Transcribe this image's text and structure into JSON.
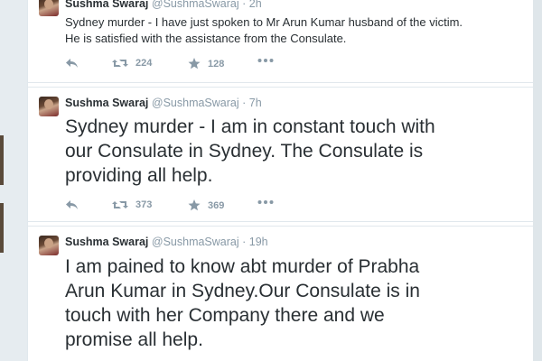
{
  "tweets": [
    {
      "author_name": "Sushma Swaraj",
      "handle": "@SushmaSwaraj",
      "time": "· 2h",
      "text_line1": "Sydney murder - I have just spoken to Mr Arun Kumar husband of the victim.",
      "text_line2": "He is satisfied with the assistance from the Consulate.",
      "retweets": "224",
      "likes": "128"
    },
    {
      "author_name": "Sushma Swaraj",
      "handle": "@SushmaSwaraj",
      "time": "· 7h",
      "text_line1": "Sydney murder - I am in constant touch with",
      "text_line2": "our Consulate in Sydney. The Consulate is",
      "text_line3": "providing all help.",
      "retweets": "373",
      "likes": "369"
    },
    {
      "author_name": "Sushma Swaraj",
      "handle": "@SushmaSwaraj",
      "time": "· 19h",
      "text_line1": "I am pained to know abt murder of Prabha",
      "text_line2": "Arun Kumar in Sydney.Our Consulate is in",
      "text_line3": "touch with her Company there and we",
      "text_line4": "promise all help."
    }
  ],
  "icons": {
    "reply": "reply-icon",
    "retweet": "retweet-icon",
    "like": "star-icon",
    "more": "more-icon"
  },
  "colors": {
    "text": "#292f33",
    "muted": "#8899a6",
    "divider": "#e1e8ed",
    "background": "#e9eef1"
  }
}
